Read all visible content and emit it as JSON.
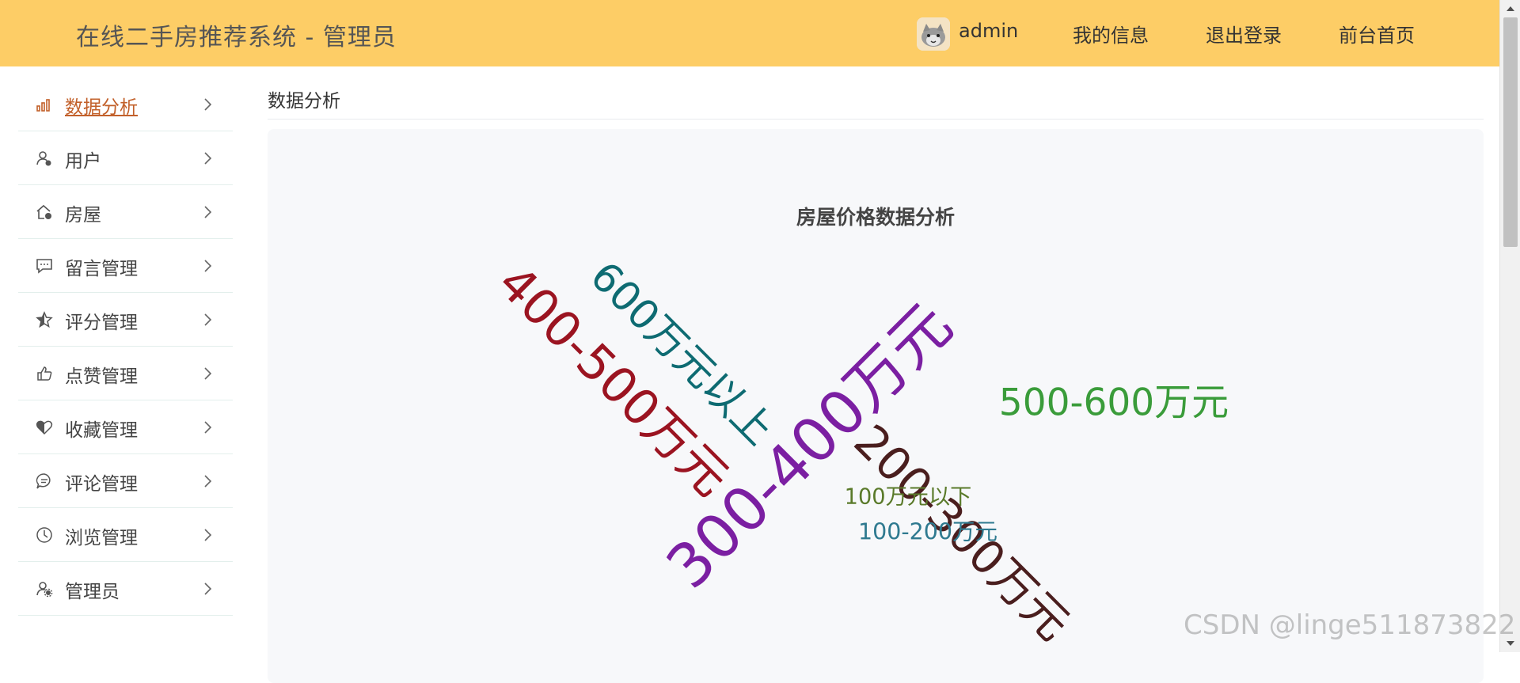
{
  "header": {
    "app_title": "在线二手房推荐系统 - 管理员",
    "username": "admin",
    "my_info": "我的信息",
    "logout": "退出登录",
    "frontend_home": "前台首页",
    "bg_color": "#fdcd66"
  },
  "sidebar": {
    "items": [
      {
        "label": "数据分析",
        "icon": "bar-chart-icon",
        "active": true
      },
      {
        "label": "用户",
        "icon": "user-icon",
        "active": false
      },
      {
        "label": "房屋",
        "icon": "house-icon",
        "active": false
      },
      {
        "label": "留言管理",
        "icon": "message-icon",
        "active": false
      },
      {
        "label": "评分管理",
        "icon": "star-icon",
        "active": false
      },
      {
        "label": "点赞管理",
        "icon": "thumbs-up-icon",
        "active": false
      },
      {
        "label": "收藏管理",
        "icon": "heart-icon",
        "active": false
      },
      {
        "label": "评论管理",
        "icon": "comment-icon",
        "active": false
      },
      {
        "label": "浏览管理",
        "icon": "clock-icon",
        "active": false
      },
      {
        "label": "管理员",
        "icon": "admin-user-icon",
        "active": false
      }
    ],
    "active_color": "#c2602a"
  },
  "main": {
    "breadcrumb": "数据分析",
    "chart_title": "房屋价格数据分析"
  },
  "chart_data": {
    "type": "wordcloud",
    "title": "房屋价格数据分析",
    "words": [
      {
        "text": "300-400万元",
        "weight": 100,
        "rotation": -45,
        "color": "#7b1fa2"
      },
      {
        "text": "400-500万元",
        "weight": 78,
        "rotation": 45,
        "color": "#9b1421"
      },
      {
        "text": "200-300万元",
        "weight": 72,
        "rotation": 45,
        "color": "#4a1e1e"
      },
      {
        "text": "600万元以上",
        "weight": 62,
        "rotation": 45,
        "color": "#0e6b72"
      },
      {
        "text": "500-600万元",
        "weight": 56,
        "rotation": 0,
        "color": "#3a9c3a"
      },
      {
        "text": "100-200万元",
        "weight": 28,
        "rotation": 0,
        "color": "#2f7a90"
      },
      {
        "text": "100万元以下",
        "weight": 26,
        "rotation": 0,
        "color": "#5a7a2a"
      }
    ]
  },
  "watermark": "CSDN @linge511873822"
}
